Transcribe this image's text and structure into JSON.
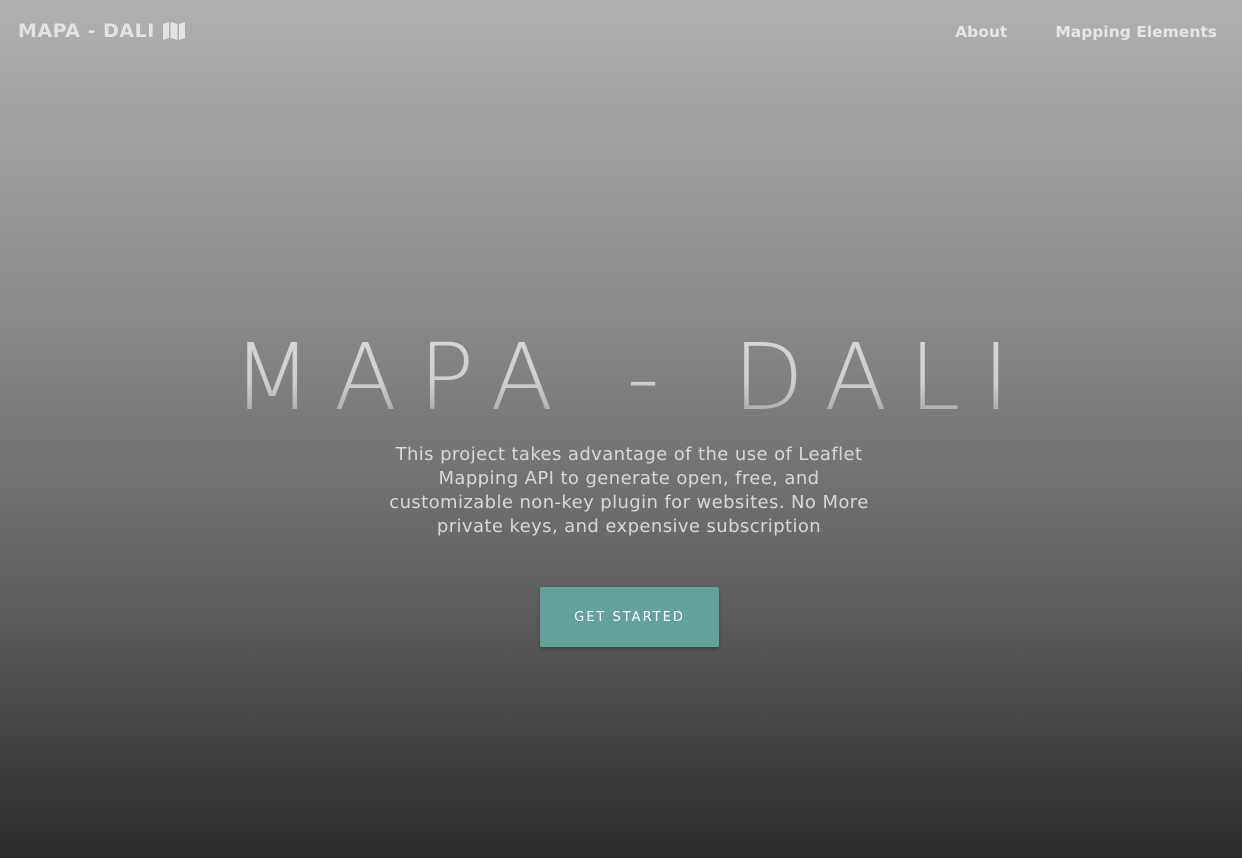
{
  "navbar": {
    "brand": "MAPA - DALI",
    "brand_icon": "map-icon",
    "links": [
      {
        "label": "About"
      },
      {
        "label": "Mapping Elements"
      }
    ]
  },
  "hero": {
    "title": "MAPA - DALI",
    "description": "This project takes advantage of the use of Leaflet Mapping API to generate open, free, and customizable non-key plugin for websites. No More private keys, and expensive subscription",
    "cta_label": "GET STARTED"
  },
  "colors": {
    "accent": "#62a19c",
    "nav_text": "#e6e6e6"
  }
}
